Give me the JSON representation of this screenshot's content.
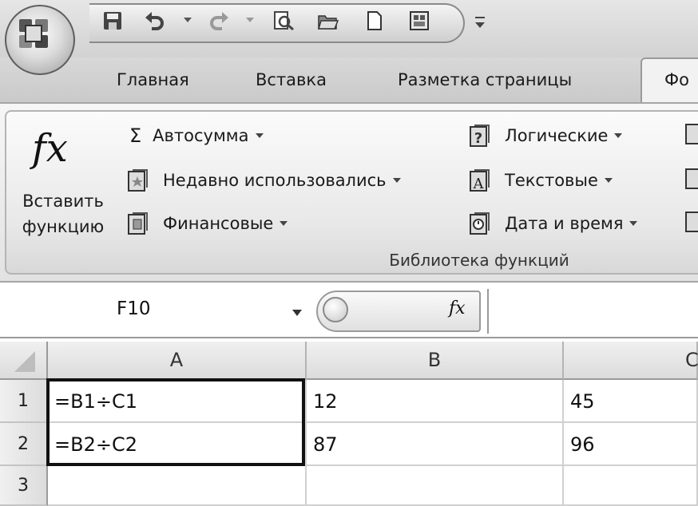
{
  "namebox": {
    "value": "F10"
  },
  "tabs": [
    {
      "label": "Главная"
    },
    {
      "label": "Вставка"
    },
    {
      "label": "Разметка страницы"
    },
    {
      "label": "Фо"
    }
  ],
  "ribbon": {
    "insert_function": {
      "line1": "Вставить",
      "line2": "функцию",
      "icon": "fx-icon"
    },
    "col1": [
      {
        "label": "Автосумма",
        "icon": "sigma-icon"
      },
      {
        "label": "Недавно использовались",
        "icon": "recent-book-icon"
      },
      {
        "label": "Финансовые",
        "icon": "finance-book-icon"
      }
    ],
    "col2": [
      {
        "label": "Логические",
        "icon": "logical-book-icon"
      },
      {
        "label": "Текстовые",
        "icon": "text-book-icon"
      },
      {
        "label": "Дата и время",
        "icon": "datetime-book-icon"
      }
    ],
    "group_label": "Библиотека функций"
  },
  "formula_bar": {
    "fx_symbol": "fx"
  },
  "sheet": {
    "columns": [
      "A",
      "B",
      "C"
    ],
    "rows": [
      {
        "num": "1",
        "A": "=B1÷C1",
        "B": "12",
        "C": "45"
      },
      {
        "num": "2",
        "A": "=B2÷C2",
        "B": "87",
        "C": "96"
      },
      {
        "num": "3",
        "A": "",
        "B": "",
        "C": ""
      }
    ]
  }
}
